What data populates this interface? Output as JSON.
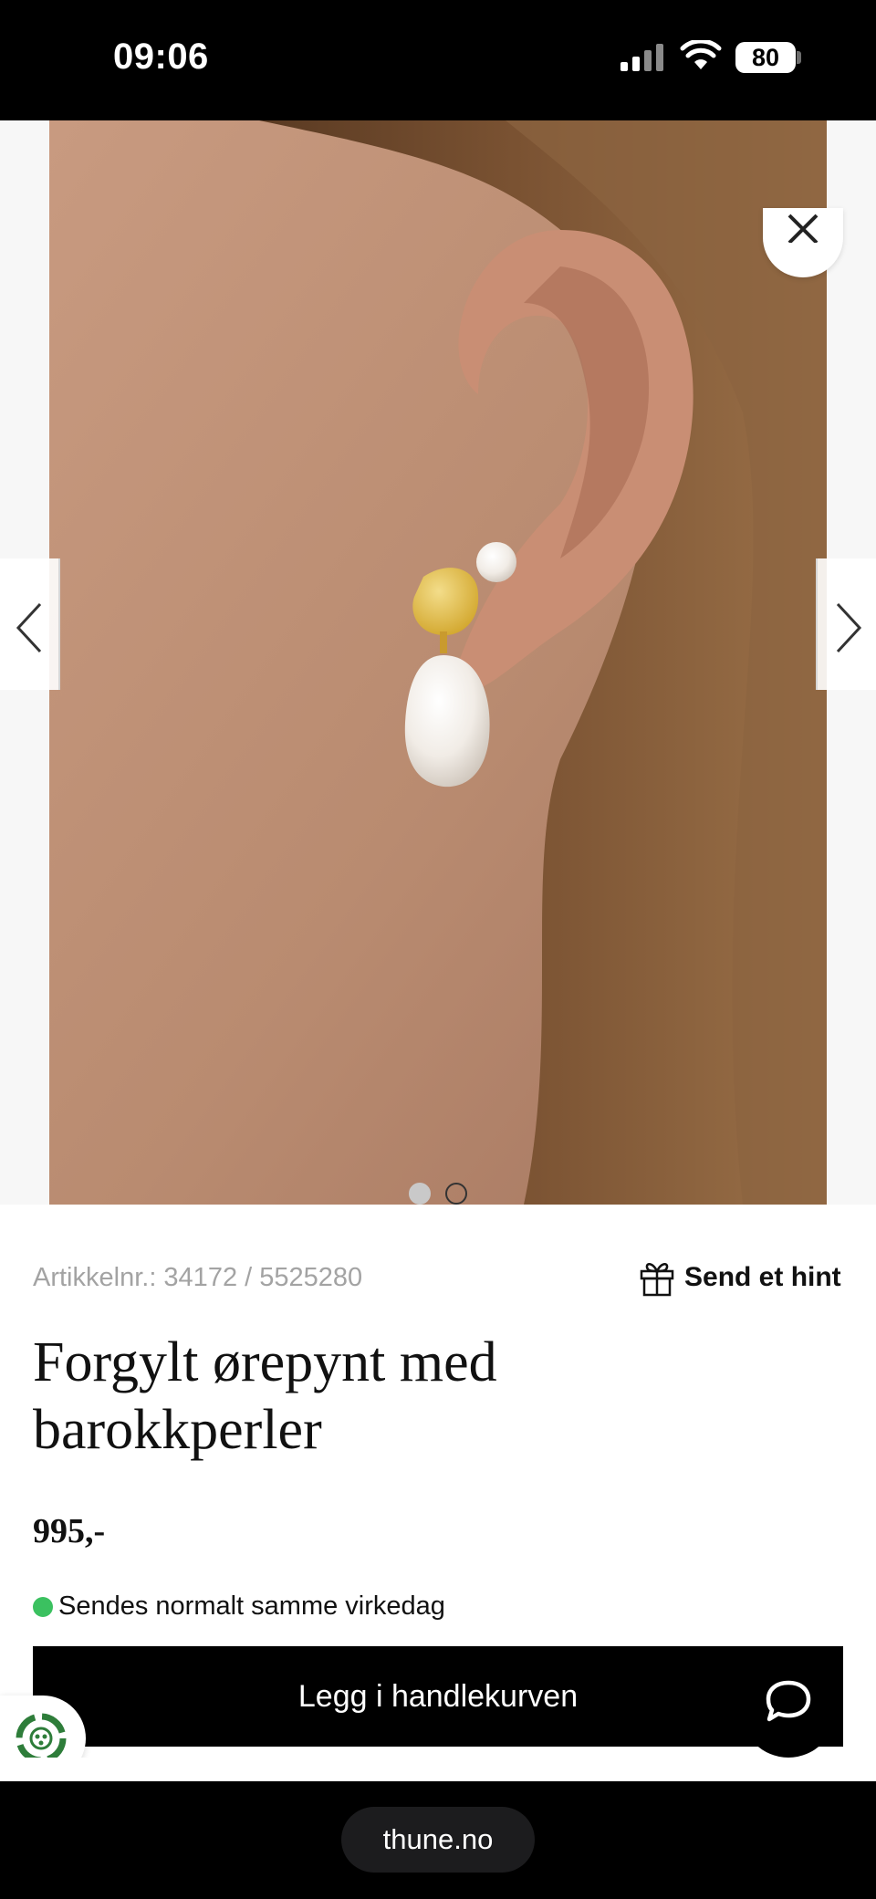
{
  "status_bar": {
    "time": "09:06",
    "battery": "80",
    "icons": [
      "signal-icon",
      "wifi-icon",
      "battery-icon"
    ]
  },
  "gallery": {
    "image_alt": "Ear wearing a gilded earring with baroque pearl and a pearl stud",
    "slide_count": 2,
    "active_slide": 1,
    "icons": [
      "close-icon",
      "chevron-left-icon",
      "chevron-right-icon"
    ]
  },
  "product": {
    "article_number": "Artikkelnr.: 34172 / 5525280",
    "hint_label": "Send et hint",
    "title_line1": "Forgylt ørepynt med",
    "title_line2": "barokkperler",
    "price": "995,-",
    "stock_status": "Sendes normalt samme virkedag",
    "add_to_cart_label": "Legg i handlekurven"
  },
  "colors": {
    "stock_indicator": "#3bc160",
    "button_background": "#000000",
    "article_number_text": "#a3a3a3"
  },
  "browser": {
    "url": "thune.no"
  }
}
